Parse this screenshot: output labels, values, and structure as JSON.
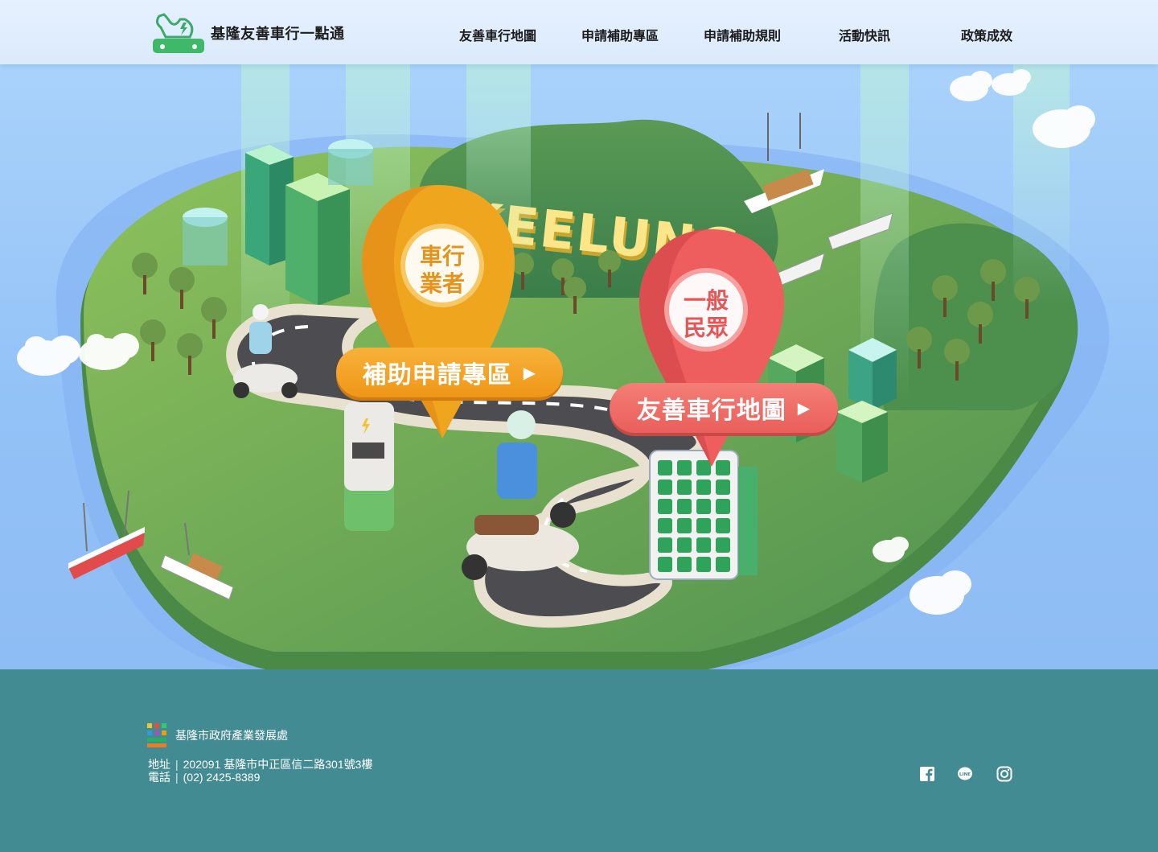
{
  "header": {
    "site_title": "基隆友善車行一點通",
    "nav": [
      {
        "label": "友善車行地圖"
      },
      {
        "label": "申請補助專區"
      },
      {
        "label": "申請補助規則"
      },
      {
        "label": "活動快訊"
      },
      {
        "label": "政策成效"
      }
    ]
  },
  "hero": {
    "title_text": "KEELUNG",
    "pin_business": {
      "line1": "車行",
      "line2": "業者",
      "color": "#f0a51e"
    },
    "pin_public": {
      "line1": "一般",
      "line2": "民眾",
      "color": "#ef5e5e"
    },
    "cta_subsidy": {
      "label": "補助申請專區",
      "icon": "play-arrow-icon"
    },
    "cta_map": {
      "label": "友善車行地圖",
      "icon": "play-arrow-icon"
    }
  },
  "footer": {
    "org_name": "基隆市政府產業發展處",
    "address_label": "地址",
    "address": "202091 基隆市中正區信二路301號3樓",
    "phone_label": "電話",
    "phone": "(02) 2425-8389",
    "social": [
      {
        "name": "facebook-icon"
      },
      {
        "name": "line-icon"
      },
      {
        "name": "instagram-icon"
      }
    ]
  },
  "colors": {
    "footer_bg": "#438b92",
    "header_bg": "#e3effd",
    "sky": "#93c2f7",
    "island": "#6aa653",
    "pin_orange": "#f0a51e",
    "pin_red": "#ef5e5e"
  }
}
